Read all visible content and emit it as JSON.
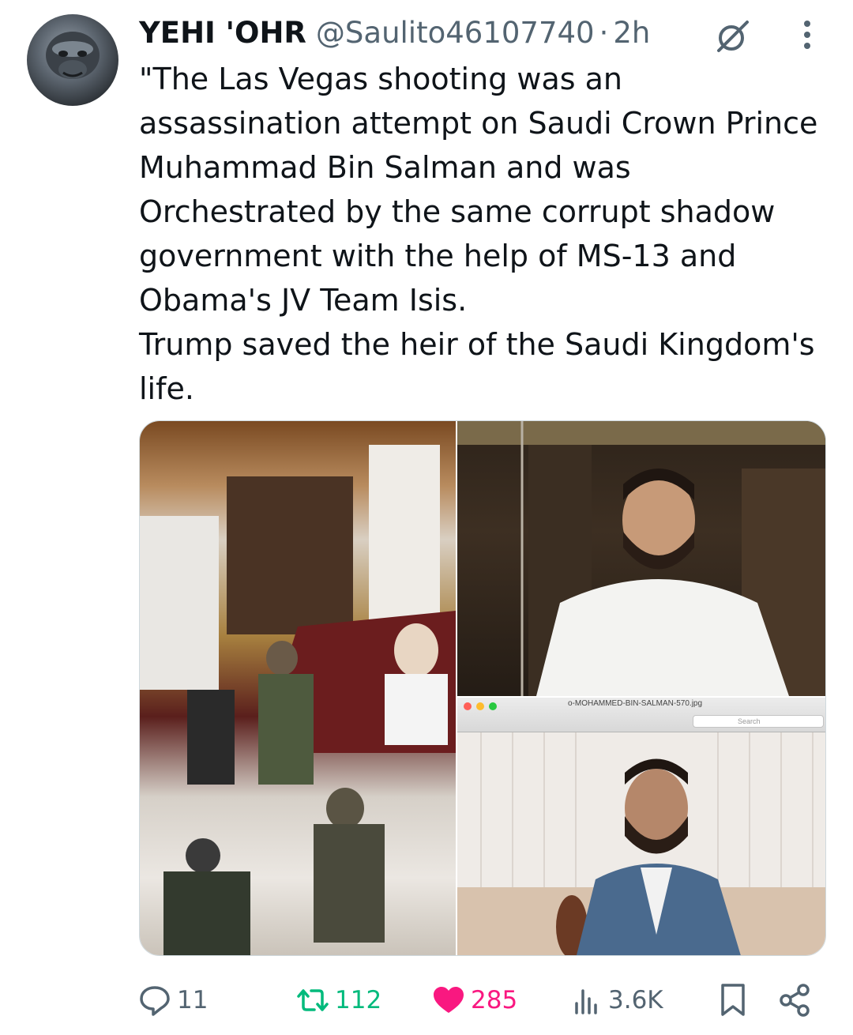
{
  "tweet": {
    "display_name": "YEHI 'OHR",
    "handle": "@Saulito46107740",
    "separator": "·",
    "time": "2h",
    "text": "\"The Las Vegas shooting was an assassination attempt on Saudi Crown Prince Muhammad Bin Salman and was Orchestrated by the same corrupt shadow government with the help of MS-13 and Obama's JV Team Isis.\nTrump saved the heir of the Saudi Kingdom's life.",
    "media": {
      "screenshot_window_title": "o-MOHAMMED-BIN-SALMAN-570.jpg",
      "screenshot_search_placeholder": "Search"
    }
  },
  "actions": {
    "replies": "11",
    "reposts": "112",
    "likes": "285",
    "views": "3.6K"
  },
  "icons": {
    "avatar": "gorilla-avatar",
    "grok": "grok-icon",
    "more": "more-vertical-icon",
    "reply": "reply-icon",
    "repost": "repost-icon",
    "like": "heart-icon",
    "views": "views-icon",
    "bookmark": "bookmark-icon",
    "share": "share-icon"
  },
  "colors": {
    "text": "#0f1419",
    "secondary": "#536471",
    "repost": "#00ba7c",
    "like": "#f91880"
  }
}
